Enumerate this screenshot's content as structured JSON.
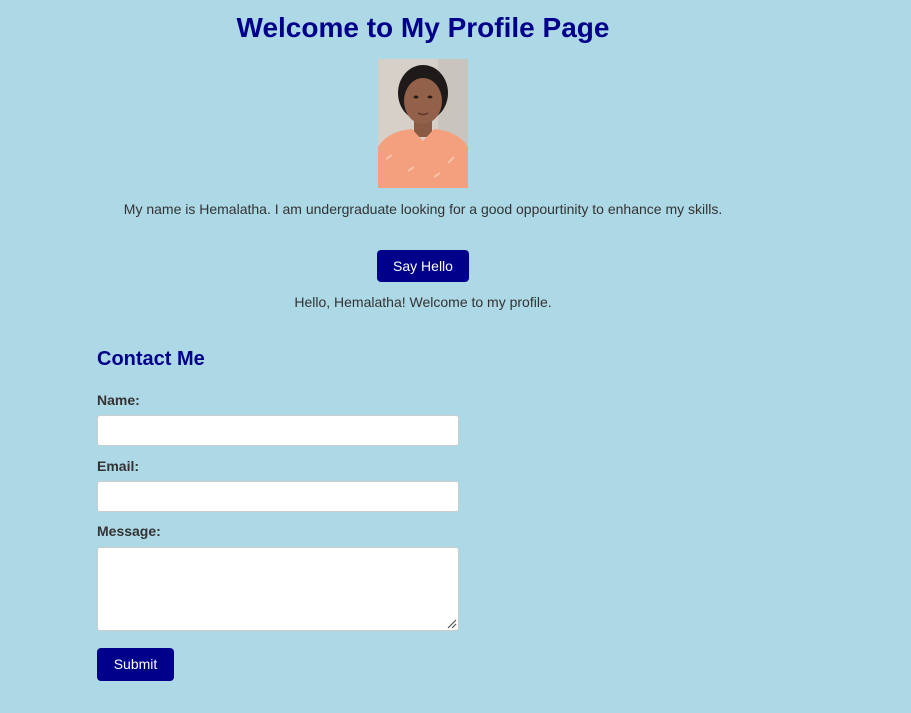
{
  "header": {
    "title": "Welcome to My Profile Page"
  },
  "profile": {
    "photo_icon": "profile-photo",
    "intro_text": "My name is Hemalatha. I am undergraduate looking for a good oppourtinity to enhance my skills.",
    "say_hello_label": "Say Hello",
    "greeting_text": "Hello, Hemalatha! Welcome to my profile."
  },
  "contact": {
    "title": "Contact Me",
    "name_label": "Name:",
    "name_value": "",
    "email_label": "Email:",
    "email_value": "",
    "message_label": "Message:",
    "message_value": "",
    "submit_label": "Submit"
  },
  "colors": {
    "background": "#add8e6",
    "accent": "#00008b",
    "text": "#333333"
  }
}
